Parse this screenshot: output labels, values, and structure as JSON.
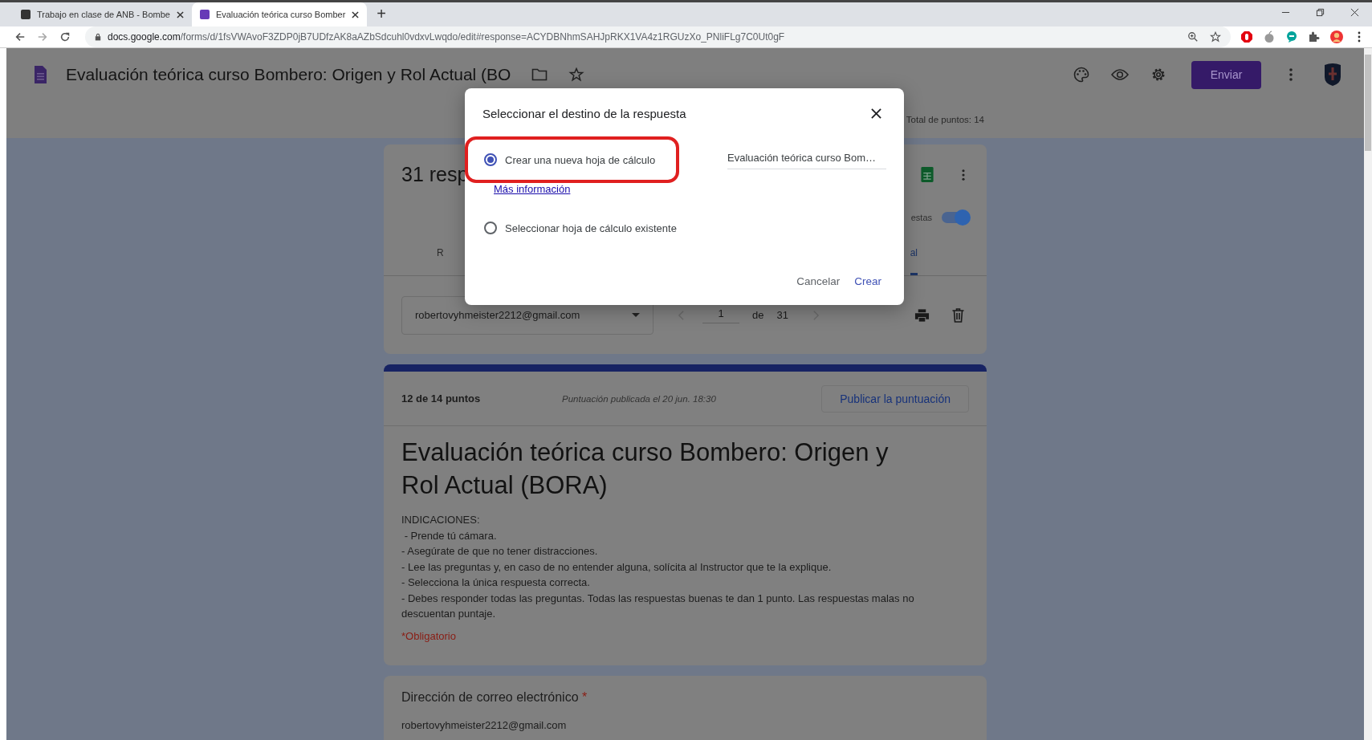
{
  "browser": {
    "tabs": [
      {
        "title": "Trabajo en clase de ANB - Bombe",
        "selected": false
      },
      {
        "title": "Evaluación teórica curso Bomber",
        "selected": true
      }
    ],
    "new_tab": "+",
    "url_host": "docs.google.com",
    "url_path": "/forms/d/1fsVWAvoF3ZDP0jB7UDfzAK8aAZbSdcuhl0vdxvLwqdo/edit#response=ACYDBNhmSAHJpRKX1VA4z1RGUzXo_PNliFLg7C0Ut0gF"
  },
  "header": {
    "title": "Evaluación teórica curso Bombero: Origen y Rol Actual (BO",
    "send_button": "Enviar",
    "total_points": "Total de puntos: 14"
  },
  "responses": {
    "count": "31 resp",
    "accepting_label": "estas",
    "accepting": true,
    "tabs": [
      {
        "label": "R",
        "selected": false
      },
      {
        "label": "al",
        "selected": true
      }
    ],
    "respondent": "robertovyhmeister2212@gmail.com",
    "page": "1",
    "page_of": "de",
    "page_total": "31"
  },
  "score_card": {
    "score": "12 de 14 puntos",
    "published": "Puntuación publicada el 20 jun. 18:30",
    "publish_button": "Publicar la puntuación",
    "title": "Evaluación teórica curso Bombero: Origen y Rol Actual (BORA)",
    "description": [
      "INDICACIONES:",
      " - Prende tú cámara.",
      "- Asegúrate de que no tener distracciones.",
      "- Lee las preguntas y, en caso de no entender alguna, solícita al Instructor que te la explique.",
      "- Selecciona la única respuesta correcta.",
      "- Debes responder todas las preguntas. Todas las respuestas buenas te dan 1 punto. Las respuestas malas no descuentan puntaje."
    ],
    "required_note": "*Obligatorio"
  },
  "question": {
    "label": "Dirección de correo electrónico",
    "required_mark": "*",
    "answer": "robertovyhmeister2212@gmail.com"
  },
  "dialog": {
    "title": "Seleccionar el destino de la respuesta",
    "options": [
      {
        "label": "Crear una nueva hoja de cálculo",
        "selected": true,
        "highlighted": true
      },
      {
        "label": "Seleccionar hoja de cálculo existente",
        "selected": false,
        "highlighted": false
      }
    ],
    "link": "Más información",
    "sheet_name": "Evaluación teórica curso Bom…",
    "cancel": "Cancelar",
    "confirm": "Crear"
  }
}
